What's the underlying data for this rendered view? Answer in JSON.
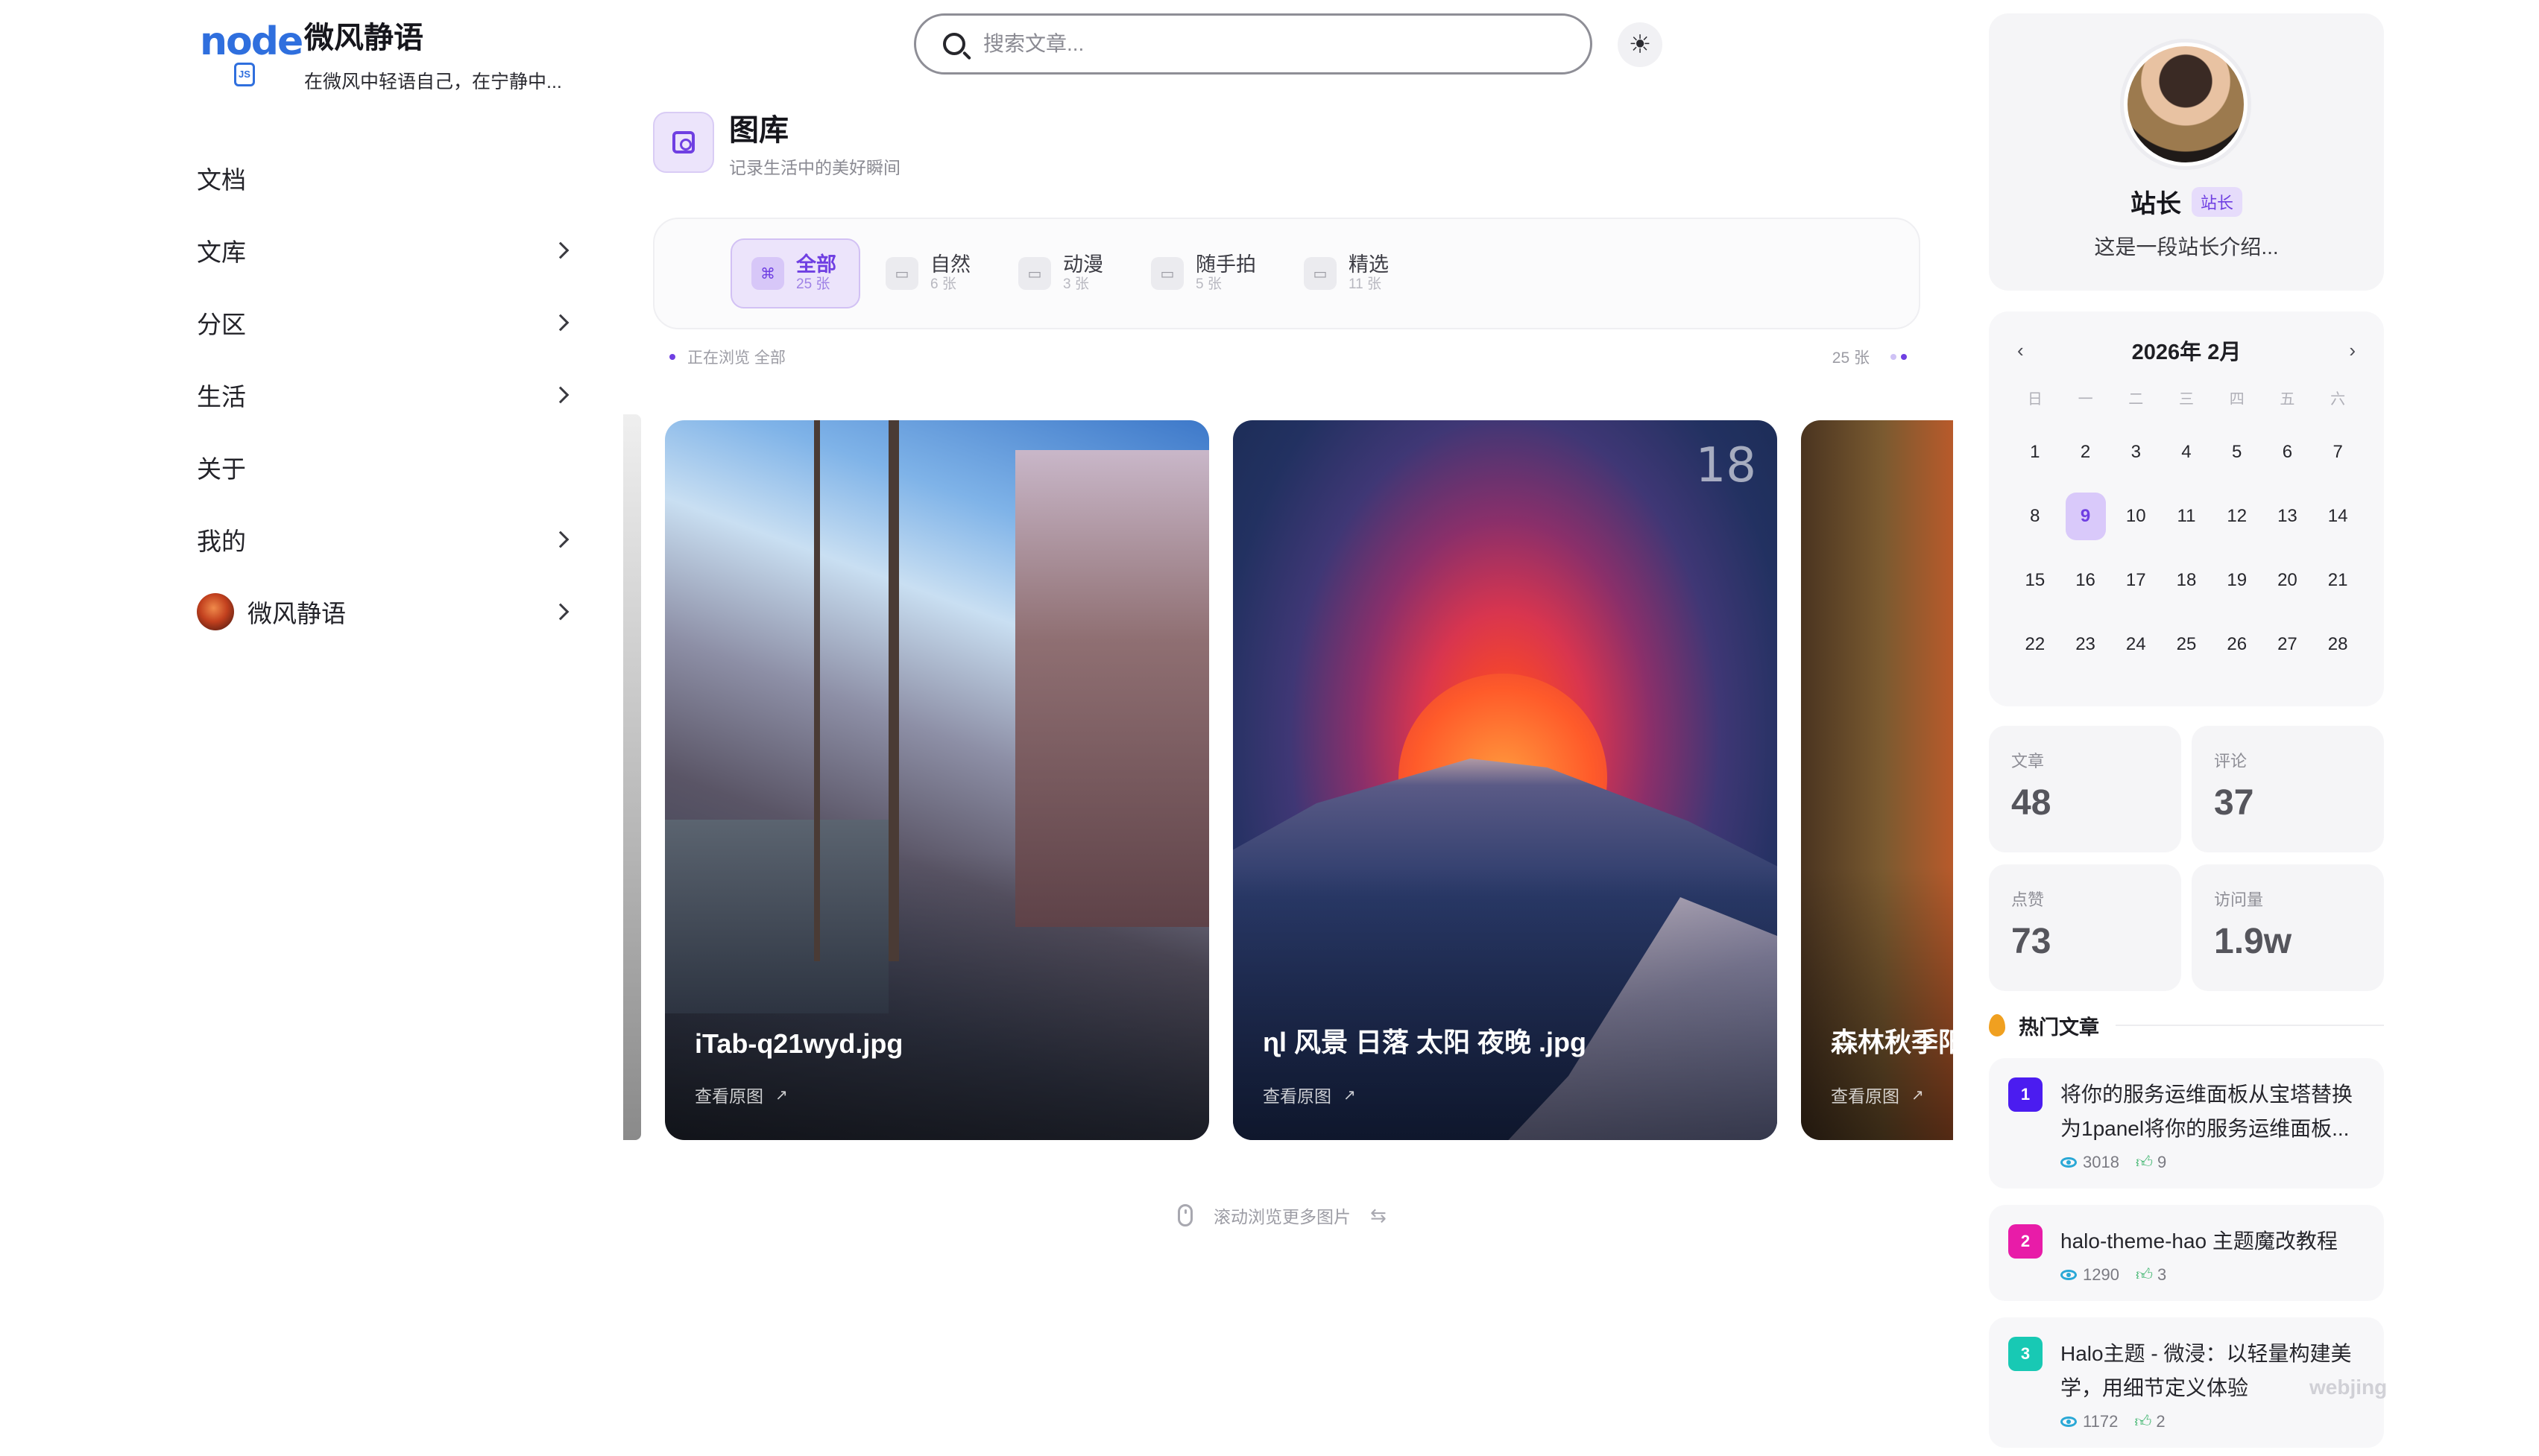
{
  "brand": {
    "logo_text": "node",
    "logo_badge": "JS",
    "title": "微风静语",
    "subtitle": "在微风中轻语自己，在宁静中..."
  },
  "nav": {
    "items": [
      {
        "label": "文档",
        "has_chevron": false
      },
      {
        "label": "文库",
        "has_chevron": true
      },
      {
        "label": "分区",
        "has_chevron": true
      },
      {
        "label": "生活",
        "has_chevron": true
      },
      {
        "label": "关于",
        "has_chevron": false
      },
      {
        "label": "我的",
        "has_chevron": true
      },
      {
        "label": "微风静语",
        "has_chevron": true,
        "avatar": true
      }
    ]
  },
  "search": {
    "placeholder": "搜索文章..."
  },
  "theme_toggle": {
    "icon": "sun-icon"
  },
  "page_header": {
    "title": "图库",
    "subtitle": "记录生活中的美好瞬间",
    "icon": "gallery-icon"
  },
  "categories": [
    {
      "label": "全部",
      "count": "25 张",
      "active": true
    },
    {
      "label": "自然",
      "count": "6 张",
      "active": false
    },
    {
      "label": "动漫",
      "count": "3 张",
      "active": false
    },
    {
      "label": "随手拍",
      "count": "5 张",
      "active": false
    },
    {
      "label": "精选",
      "count": "11 张",
      "active": false
    }
  ],
  "status": {
    "browsing": "正在浏览 全部",
    "total": "25 张"
  },
  "gallery": {
    "cards": [
      {
        "title": "iTab-q21wyd.jpg",
        "link": "查看原图"
      },
      {
        "title": "ɳl 风景 日落 太阳 夜晚 .jpg",
        "link": "查看原图",
        "badge": "18"
      },
      {
        "title": "森林秋季阳",
        "link": "查看原图"
      }
    ]
  },
  "scroll_hint": "滚动浏览更多图片",
  "profile": {
    "name": "站长",
    "badge": "站长",
    "description": "这是一段站长介绍..."
  },
  "calendar": {
    "title": "2026年 2月",
    "weekdays": [
      "日",
      "一",
      "二",
      "三",
      "四",
      "五",
      "六"
    ],
    "days": [
      "1",
      "2",
      "3",
      "4",
      "5",
      "6",
      "7",
      "8",
      "9",
      "10",
      "11",
      "12",
      "13",
      "14",
      "15",
      "16",
      "17",
      "18",
      "19",
      "20",
      "21",
      "22",
      "23",
      "24",
      "25",
      "26",
      "27",
      "28"
    ],
    "today": "9"
  },
  "stats": [
    {
      "label": "文章",
      "value": "48"
    },
    {
      "label": "评论",
      "value": "37"
    },
    {
      "label": "点赞",
      "value": "73"
    },
    {
      "label": "访问量",
      "value": "1.9w"
    }
  ],
  "hot": {
    "title": "热门文章",
    "items": [
      {
        "rank": "1",
        "color": "#4b1cf0",
        "text": "将你的服务运维面板从宝塔替换为1panel将你的服务运维面板...",
        "views": "3018",
        "likes": "9"
      },
      {
        "rank": "2",
        "color": "#e81ca8",
        "text": "halo-theme-hao 主题魔改教程",
        "views": "1290",
        "likes": "3"
      },
      {
        "rank": "3",
        "color": "#18c9b4",
        "text": "Halo主题 - 微浸：以轻量构建美学，用细节定义体验",
        "views": "1172",
        "likes": "2"
      }
    ]
  },
  "watermark": "webjing"
}
